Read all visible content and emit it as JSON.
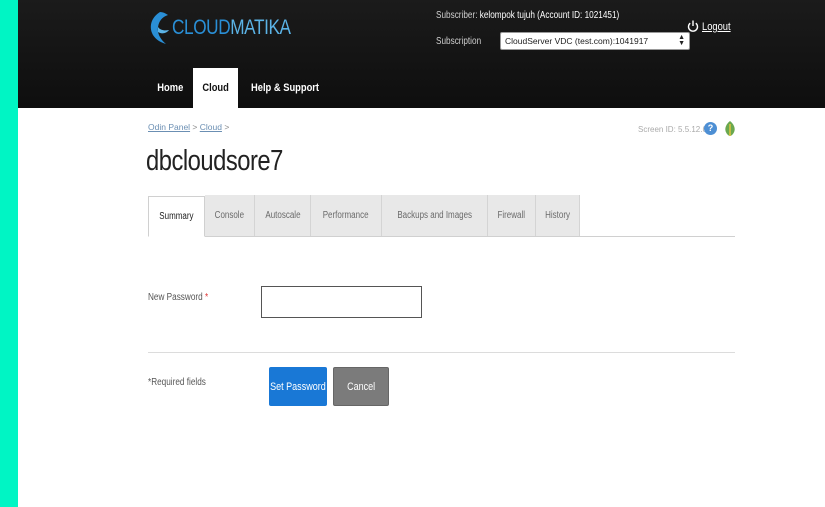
{
  "brand": {
    "logo_text_a": "CLOUD",
    "logo_text_b": "MATIKA",
    "accent": "#2a8fd6"
  },
  "header": {
    "subscriber_label": "Subscriber:",
    "subscriber_value": "kelompok tujuh (Account ID: 1021451)",
    "subscription_label": "Subscription",
    "subscription_selected": "CloudServer VDC (test.com):1041917",
    "logout_label": "Logout"
  },
  "nav": {
    "items": [
      {
        "label": "Home",
        "active": false
      },
      {
        "label": "Cloud",
        "active": true
      },
      {
        "label": "Help & Support",
        "active": false
      }
    ]
  },
  "breadcrumb": {
    "items": [
      "Odin Panel",
      "Cloud"
    ]
  },
  "screen_id": "Screen ID: 5.5.12.61",
  "page_title": "dbcloudsore7",
  "tabs": [
    {
      "label": "Summary",
      "active": true
    },
    {
      "label": "Console",
      "active": false
    },
    {
      "label": "Autoscale",
      "active": false
    },
    {
      "label": "Performance",
      "active": false
    },
    {
      "label": "Backups and Images",
      "active": false
    },
    {
      "label": "Firewall",
      "active": false
    },
    {
      "label": "History",
      "active": false
    }
  ],
  "form": {
    "password_label": "New Password",
    "required_mark": "*",
    "password_value": "",
    "required_note": "*Required fields",
    "submit_label": "Set Password",
    "cancel_label": "Cancel"
  },
  "icons": {
    "help": "help-icon",
    "leaf": "leaf-icon",
    "power": "power-icon"
  }
}
